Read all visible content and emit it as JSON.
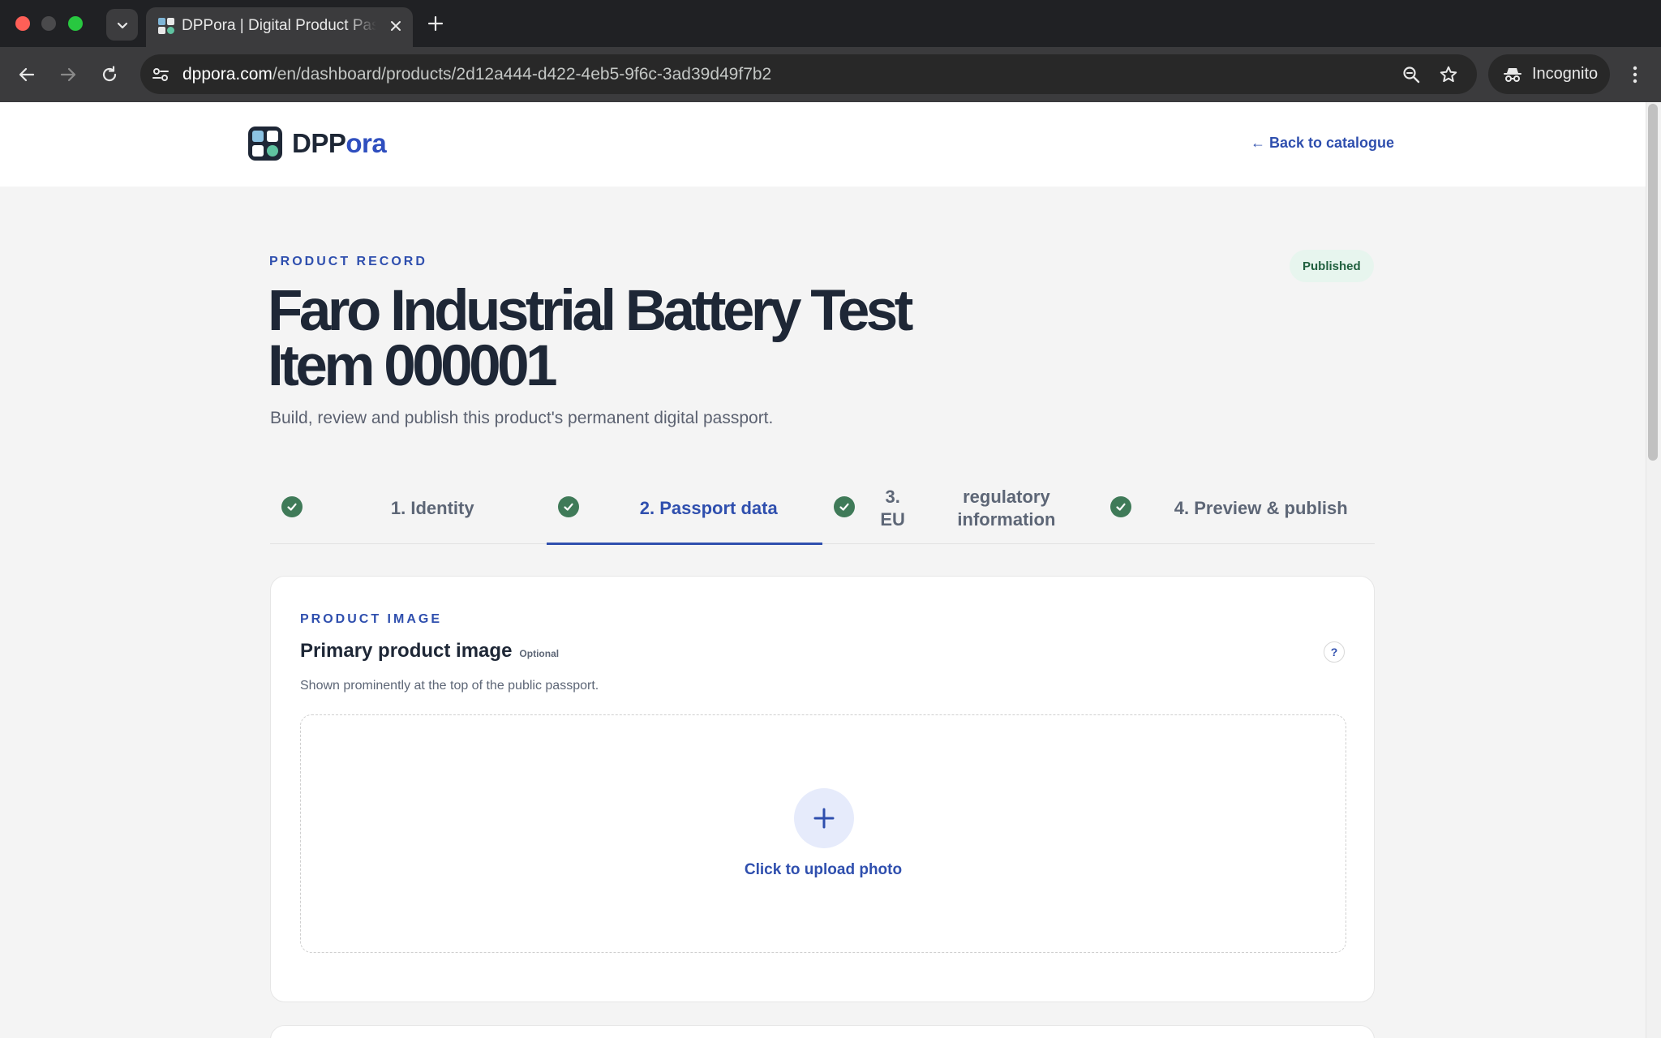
{
  "browser": {
    "tab_title": "DPPora | Digital Product Passport",
    "url_host": "dppora.com",
    "url_path": "/en/dashboard/products/2d12a444-d422-4eb5-9f6c-3ad39d49f7b2",
    "incognito_label": "Incognito"
  },
  "header": {
    "logo_text_main": "DPP",
    "logo_text_accent": "ora",
    "back_link": "← Back to catalogue"
  },
  "record": {
    "eyebrow": "PRODUCT RECORD",
    "status": "Published",
    "title": "Faro Industrial Battery Test Item 000001",
    "subtitle": "Build, review and publish this product's permanent digital passport."
  },
  "steps": [
    {
      "label": "1. Identity",
      "completed": true,
      "active": false
    },
    {
      "label": "2. Passport data",
      "completed": true,
      "active": true
    },
    {
      "label": "3. EU regulatory information",
      "label_line1": "3. EU",
      "label_line2": "regulatory information",
      "completed": true,
      "active": false
    },
    {
      "label": "4. Preview & publish",
      "completed": true,
      "active": false
    }
  ],
  "image_section": {
    "eyebrow": "PRODUCT IMAGE",
    "title": "Primary product image",
    "optional": "Optional",
    "help": "?",
    "hint": "Shown prominently at the top of the public passport.",
    "upload_label": "Click to upload photo"
  },
  "colors": {
    "accent": "#2f4fae",
    "success": "#3f7a58",
    "badge_bg": "#e7f5ee",
    "heading": "#1e2736"
  }
}
